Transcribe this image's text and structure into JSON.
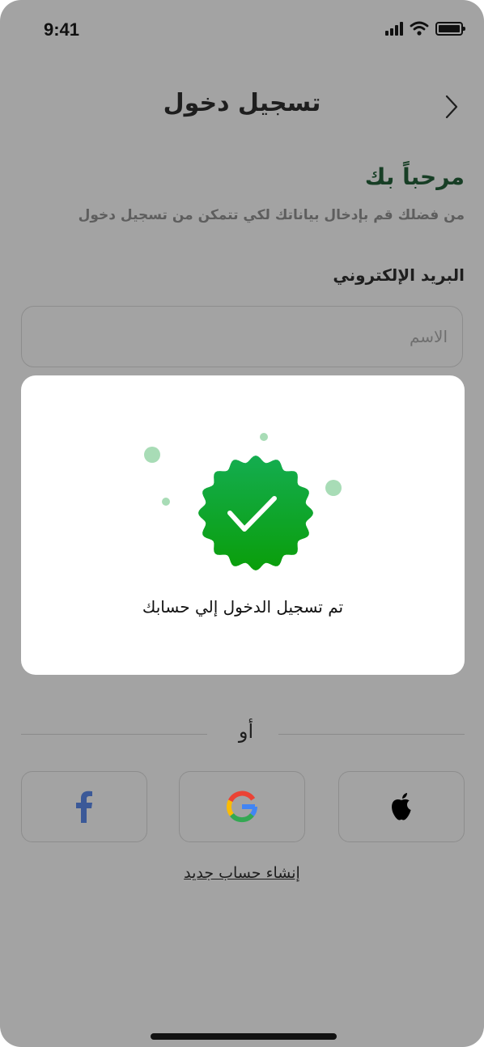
{
  "status_bar": {
    "time": "9:41"
  },
  "header": {
    "title": "تسجيل دخول"
  },
  "intro": {
    "welcome": "مرحباً بك",
    "subtitle": "من فضلك قم بإدخال بياناتك لكي تتمكن من تسجيل دخول"
  },
  "form": {
    "email_label": "البريد الإلكتروني",
    "email_placeholder": "الاسم",
    "email_value": ""
  },
  "success_modal": {
    "message": "تم تسجيل الدخول إلي حسابك",
    "icon": "success-badge-check-icon",
    "colors": {
      "badge_top": "#14ad50",
      "badge_bottom": "#0a9e0a",
      "dots": "#a8dcb6"
    }
  },
  "divider": {
    "or_label": "أو"
  },
  "social": {
    "buttons": [
      {
        "icon": "facebook-icon",
        "color": "#3b5998"
      },
      {
        "icon": "google-icon"
      },
      {
        "icon": "apple-icon",
        "color": "#000000"
      }
    ]
  },
  "footer": {
    "signup_label": "إنشاء حساب جديد"
  },
  "colors": {
    "backdrop": "#a3a3a3",
    "welcome": "#173e25"
  }
}
